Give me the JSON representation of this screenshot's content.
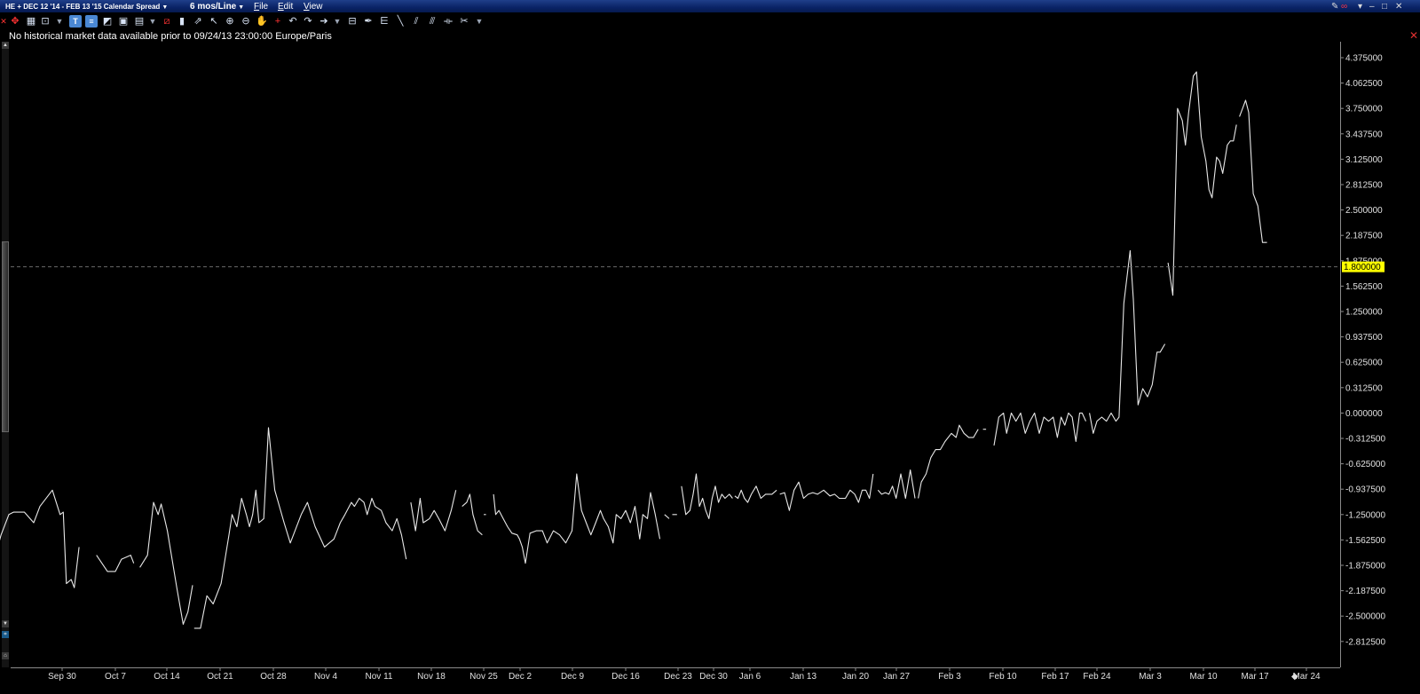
{
  "window": {
    "title": "HE + DEC 12 '14 - FEB 13 '15 Calendar Spread",
    "period_selector": "6 mos/Line",
    "menus": [
      "File",
      "Edit",
      "View"
    ]
  },
  "toolbar": {
    "icons": [
      "close-icon",
      "crosshair-icon",
      "grid-icon",
      "zoom-box-icon",
      "chevron-down-icon",
      "indicator-t-icon",
      "indicator-list-icon",
      "chart-settings-icon",
      "export-image-icon",
      "layout-icon",
      "chevron-down-icon",
      "draw-line-icon",
      "bar-chart-icon",
      "cursor-icon",
      "zoom-in-icon",
      "zoom-out-icon",
      "hand-icon",
      "crosshair-tool-icon",
      "undo-icon",
      "redo-icon",
      "arrow-right-icon",
      "chevron-down-icon",
      "ruler-icon",
      "pen-icon",
      "fib-icon",
      "trend-line-icon",
      "channel-icon",
      "multi-line-icon",
      "bracket-icon",
      "split-icon",
      "wrench-icon",
      "chevron-down-icon"
    ]
  },
  "notice": "No historical market data available prior to 09/24/13 23:00:00 Europe/Paris",
  "colors": {
    "background": "#000000",
    "line": "#e8e8e8",
    "price_marker": "#ffff00",
    "title_bar": "#0a2366"
  },
  "chart_data": {
    "type": "line",
    "price_marker": "1.800000",
    "y_ticks": [
      "4.375000",
      "4.062500",
      "3.750000",
      "3.437500",
      "3.125000",
      "2.812500",
      "2.500000",
      "2.187500",
      "1.875000",
      "1.562500",
      "1.250000",
      "0.937500",
      "0.625000",
      "0.312500",
      "0.000000",
      "-0.312500",
      "-0.625000",
      "-0.937500",
      "-1.250000",
      "-1.562500",
      "-1.875000",
      "-2.187500",
      "-2.500000",
      "-2.812500"
    ],
    "x_ticks": [
      "Sep 30",
      "Oct 7",
      "Oct 14",
      "Oct 21",
      "Oct 28",
      "Nov 4",
      "Nov 11",
      "Nov 18",
      "Nov 25",
      "Dec 2",
      "Dec 9",
      "Dec 16",
      "Dec 23",
      "Dec 30",
      "Jan 6",
      "Jan 13",
      "Jan 20",
      "Jan 27",
      "Feb 3",
      "Feb 10",
      "Feb 17",
      "Feb 24",
      "Mar 3",
      "Mar 10",
      "Mar 17",
      "Mar 24"
    ],
    "ylim": [
      -3.15,
      4.6
    ],
    "grid": false,
    "segments": [
      [
        [
          0.0,
          -2.25
        ],
        [
          0.5,
          -2.25
        ],
        [
          1.0,
          -1.85
        ],
        [
          1.3,
          -1.85
        ],
        [
          1.8,
          -1.5
        ],
        [
          2.3,
          -1.25
        ],
        [
          2.6,
          -1.22
        ],
        [
          3.1,
          -1.22
        ],
        [
          3.3,
          -1.22
        ],
        [
          3.9,
          -1.35
        ],
        [
          4.3,
          -1.15
        ],
        [
          5.1,
          -0.95
        ],
        [
          5.6,
          -1.25
        ],
        [
          5.8,
          -1.22
        ],
        [
          6.0,
          -2.1
        ],
        [
          6.3,
          -2.05
        ],
        [
          6.5,
          -2.15
        ],
        [
          6.8,
          -1.65
        ]
      ],
      [
        [
          7.9,
          -1.75
        ],
        [
          8.6,
          -1.95
        ],
        [
          9.1,
          -1.95
        ],
        [
          9.5,
          -1.8
        ],
        [
          10.1,
          -1.75
        ],
        [
          10.3,
          -1.85
        ]
      ],
      [
        [
          10.7,
          -1.9
        ],
        [
          11.2,
          -1.75
        ],
        [
          11.6,
          -1.1
        ],
        [
          11.9,
          -1.25
        ],
        [
          12.1,
          -1.12
        ],
        [
          12.5,
          -1.45
        ],
        [
          13.1,
          -2.15
        ],
        [
          13.5,
          -2.6
        ],
        [
          13.8,
          -2.45
        ],
        [
          14.1,
          -2.12
        ]
      ],
      [
        [
          14.2,
          -2.65
        ],
        [
          14.6,
          -2.65
        ],
        [
          15.0,
          -2.25
        ],
        [
          15.4,
          -2.35
        ],
        [
          15.9,
          -2.1
        ],
        [
          16.4,
          -1.5
        ],
        [
          16.6,
          -1.25
        ],
        [
          16.9,
          -1.4
        ],
        [
          17.2,
          -1.05
        ],
        [
          17.5,
          -1.25
        ],
        [
          17.7,
          -1.4
        ],
        [
          17.9,
          -1.25
        ],
        [
          18.1,
          -0.95
        ],
        [
          18.3,
          -1.35
        ],
        [
          18.6,
          -1.3
        ],
        [
          18.9,
          -0.18
        ],
        [
          19.3,
          -0.95
        ],
        [
          19.9,
          -1.35
        ],
        [
          20.3,
          -1.6
        ],
        [
          20.6,
          -1.45
        ],
        [
          21.0,
          -1.25
        ],
        [
          21.4,
          -1.1
        ],
        [
          21.9,
          -1.4
        ],
        [
          22.5,
          -1.65
        ],
        [
          23.1,
          -1.55
        ],
        [
          23.5,
          -1.35
        ],
        [
          23.8,
          -1.25
        ],
        [
          24.2,
          -1.1
        ],
        [
          24.4,
          -1.15
        ],
        [
          24.7,
          -1.05
        ],
        [
          25.0,
          -1.1
        ],
        [
          25.2,
          -1.25
        ],
        [
          25.5,
          -1.05
        ],
        [
          25.7,
          -1.15
        ],
        [
          26.1,
          -1.2
        ],
        [
          26.4,
          -1.35
        ],
        [
          26.8,
          -1.45
        ],
        [
          27.1,
          -1.3
        ],
        [
          27.4,
          -1.5
        ],
        [
          27.7,
          -1.8
        ]
      ],
      [
        [
          28.0,
          -1.1
        ],
        [
          28.3,
          -1.45
        ],
        [
          28.6,
          -1.05
        ],
        [
          28.8,
          -1.35
        ],
        [
          29.2,
          -1.3
        ],
        [
          29.5,
          -1.2
        ],
        [
          29.8,
          -1.3
        ],
        [
          30.2,
          -1.45
        ],
        [
          30.6,
          -1.2
        ],
        [
          30.9,
          -0.95
        ]
      ],
      [
        [
          31.3,
          -1.15
        ],
        [
          31.6,
          -1.1
        ],
        [
          31.8,
          -1.0
        ],
        [
          32.0,
          -1.25
        ],
        [
          32.3,
          -1.45
        ],
        [
          32.6,
          -1.5
        ]
      ],
      [
        [
          32.7,
          -1.25
        ],
        [
          32.9,
          -1.25
        ]
      ],
      [
        [
          33.6,
          -1.0
        ],
        [
          33.8,
          -1.25
        ],
        [
          34.1,
          -1.2
        ],
        [
          34.5,
          -1.3
        ],
        [
          34.9,
          -1.4
        ],
        [
          35.3,
          -1.48
        ],
        [
          35.8,
          -1.5
        ],
        [
          36.0,
          -1.55
        ],
        [
          36.2,
          -1.65
        ],
        [
          36.4,
          -1.85
        ],
        [
          36.7,
          -1.48
        ],
        [
          37.1,
          -1.45
        ],
        [
          37.5,
          -1.45
        ],
        [
          37.8,
          -1.6
        ],
        [
          38.2,
          -1.45
        ],
        [
          38.6,
          -1.5
        ],
        [
          39.0,
          -1.6
        ],
        [
          39.4,
          -1.45
        ],
        [
          39.7,
          -0.75
        ],
        [
          40.0,
          -1.2
        ],
        [
          40.3,
          -1.35
        ],
        [
          40.6,
          -1.5
        ],
        [
          40.9,
          -1.35
        ],
        [
          41.2,
          -1.2
        ],
        [
          41.4,
          -1.3
        ],
        [
          41.7,
          -1.4
        ],
        [
          42.0,
          -1.6
        ],
        [
          42.2,
          -1.25
        ],
        [
          42.5,
          -1.3
        ],
        [
          42.8,
          -1.2
        ],
        [
          43.1,
          -1.35
        ],
        [
          43.4,
          -1.15
        ],
        [
          43.7,
          -1.55
        ],
        [
          43.9,
          -1.25
        ],
        [
          44.2,
          -1.3
        ],
        [
          44.4,
          -0.98
        ],
        [
          44.7,
          -1.25
        ],
        [
          45.0,
          -1.55
        ]
      ],
      [
        [
          45.3,
          -1.25
        ],
        [
          45.6,
          -1.3
        ]
      ],
      [
        [
          45.8,
          -1.25
        ],
        [
          46.1,
          -1.25
        ]
      ],
      [
        [
          46.5,
          -0.9
        ],
        [
          46.9,
          -1.25
        ],
        [
          47.3,
          -1.2
        ],
        [
          47.6,
          -1.0
        ],
        [
          47.9,
          -0.75
        ],
        [
          48.2,
          -1.15
        ],
        [
          48.5,
          -1.05
        ],
        [
          48.8,
          -1.2
        ],
        [
          49.1,
          -1.3
        ],
        [
          49.4,
          -1.05
        ],
        [
          49.7,
          -0.9
        ],
        [
          50.0,
          -1.1
        ],
        [
          50.3,
          -1.0
        ],
        [
          50.6,
          -1.05
        ],
        [
          51.0,
          -1.0
        ],
        [
          51.3,
          -1.05
        ]
      ],
      [
        [
          51.5,
          -1.02
        ],
        [
          51.8,
          -1.05
        ],
        [
          52.1,
          -0.95
        ],
        [
          52.4,
          -1.05
        ],
        [
          52.7,
          -1.1
        ],
        [
          53.0,
          -1.0
        ],
        [
          53.3,
          -0.9
        ],
        [
          53.6,
          -1.05
        ],
        [
          53.9,
          -1.0
        ],
        [
          54.3,
          -1.0
        ],
        [
          54.6,
          -0.95
        ]
      ],
      [
        [
          54.8,
          -1.0
        ],
        [
          55.1,
          -0.98
        ],
        [
          55.4,
          -1.2
        ],
        [
          55.7,
          -0.95
        ],
        [
          56.0,
          -0.85
        ],
        [
          56.3,
          -1.05
        ],
        [
          56.6,
          -1.0
        ],
        [
          56.9,
          -0.98
        ],
        [
          57.2,
          -1.0
        ],
        [
          57.6,
          -0.95
        ],
        [
          58.0,
          -1.02
        ],
        [
          58.3,
          -1.0
        ],
        [
          58.6,
          -1.05
        ],
        [
          59.0,
          -1.05
        ],
        [
          59.3,
          -0.95
        ],
        [
          59.6,
          -1.0
        ],
        [
          59.9,
          -1.1
        ],
        [
          60.2,
          -0.95
        ],
        [
          60.5,
          -0.95
        ],
        [
          60.8,
          -1.05
        ],
        [
          61.1,
          -0.75
        ]
      ],
      [
        [
          61.5,
          -0.95
        ],
        [
          61.8,
          -1.0
        ],
        [
          62.1,
          -0.98
        ],
        [
          62.4,
          -1.0
        ],
        [
          62.7,
          -0.9
        ],
        [
          63.0,
          -1.05
        ],
        [
          63.3,
          -0.75
        ],
        [
          63.6,
          -1.05
        ],
        [
          63.9,
          -0.7
        ],
        [
          64.2,
          -1.05
        ]
      ],
      [
        [
          64.4,
          -1.05
        ],
        [
          64.6,
          -0.85
        ],
        [
          64.9,
          -0.75
        ],
        [
          65.2,
          -0.55
        ],
        [
          65.5,
          -0.45
        ],
        [
          65.8,
          -0.45
        ],
        [
          66.1,
          -0.35
        ],
        [
          66.5,
          -0.25
        ],
        [
          66.8,
          -0.3
        ],
        [
          67.0,
          -0.15
        ],
        [
          67.3,
          -0.25
        ],
        [
          67.6,
          -0.3
        ],
        [
          67.9,
          -0.3
        ],
        [
          68.2,
          -0.2
        ]
      ],
      [
        [
          68.5,
          -0.2
        ],
        [
          68.7,
          -0.2
        ]
      ],
      [
        [
          69.2,
          -0.4
        ],
        [
          69.5,
          -0.05
        ],
        [
          69.8,
          0.0
        ],
        [
          70.0,
          -0.25
        ],
        [
          70.3,
          0.0
        ],
        [
          70.6,
          -0.1
        ],
        [
          70.9,
          0.0
        ],
        [
          71.2,
          -0.25
        ],
        [
          71.5,
          -0.1
        ],
        [
          71.8,
          0.0
        ],
        [
          72.1,
          -0.25
        ],
        [
          72.4,
          -0.05
        ],
        [
          72.7,
          -0.1
        ],
        [
          73.0,
          -0.05
        ],
        [
          73.3,
          -0.3
        ],
        [
          73.6,
          -0.05
        ],
        [
          73.9,
          -0.15
        ],
        [
          74.2,
          0.0
        ],
        [
          74.5,
          -0.05
        ],
        [
          74.8,
          -0.35
        ],
        [
          75.1,
          0.0
        ],
        [
          75.3,
          0.0
        ],
        [
          75.6,
          -0.1
        ]
      ],
      [
        [
          75.9,
          0.0
        ],
        [
          76.2,
          -0.25
        ],
        [
          76.5,
          -0.1
        ],
        [
          76.8,
          -0.05
        ],
        [
          77.1,
          -0.1
        ],
        [
          77.4,
          0.0
        ],
        [
          77.7,
          -0.1
        ],
        [
          77.9,
          -0.05
        ],
        [
          78.2,
          1.35
        ],
        [
          78.6,
          2.0
        ],
        [
          78.8,
          1.4
        ],
        [
          79.1,
          0.1
        ],
        [
          79.4,
          0.3
        ],
        [
          79.7,
          0.2
        ],
        [
          80.0,
          0.35
        ],
        [
          80.3,
          0.75
        ],
        [
          80.5,
          0.75
        ],
        [
          80.8,
          0.85
        ]
      ],
      [
        [
          81.0,
          1.85
        ],
        [
          81.3,
          1.45
        ],
        [
          81.6,
          3.75
        ],
        [
          81.9,
          3.6
        ],
        [
          82.1,
          3.3
        ],
        [
          82.3,
          3.7
        ],
        [
          82.6,
          4.15
        ],
        [
          82.8,
          4.2
        ],
        [
          83.1,
          3.4
        ],
        [
          83.4,
          3.1
        ],
        [
          83.6,
          2.75
        ],
        [
          83.8,
          2.65
        ],
        [
          84.1,
          3.15
        ],
        [
          84.3,
          3.1
        ],
        [
          84.5,
          2.95
        ],
        [
          84.8,
          3.3
        ],
        [
          85.0,
          3.35
        ],
        [
          85.2,
          3.35
        ],
        [
          85.4,
          3.55
        ]
      ],
      [
        [
          85.6,
          3.65
        ],
        [
          85.8,
          3.75
        ],
        [
          86.0,
          3.85
        ],
        [
          86.2,
          3.7
        ],
        [
          86.5,
          2.7
        ],
        [
          86.8,
          2.55
        ],
        [
          87.1,
          2.1
        ],
        [
          87.4,
          2.1
        ]
      ]
    ]
  }
}
